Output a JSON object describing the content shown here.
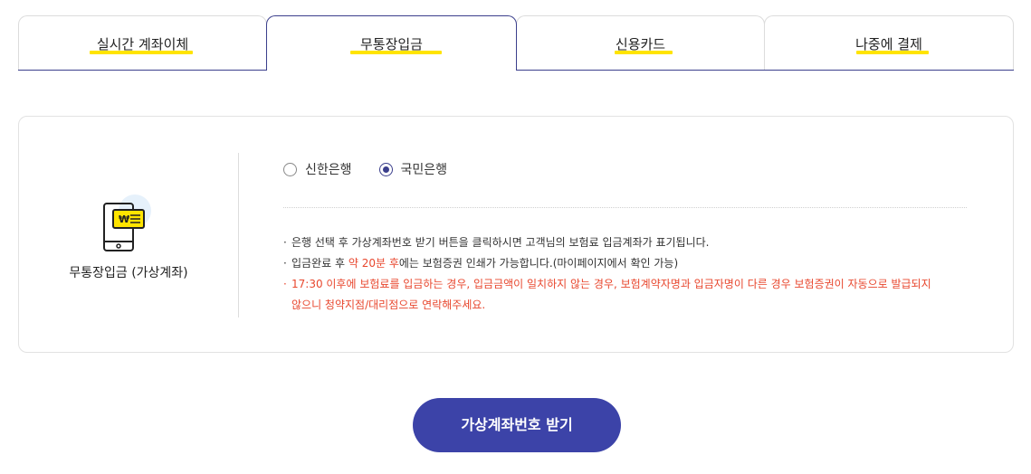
{
  "tabs": [
    {
      "label": "실시간 계좌이체",
      "active": false
    },
    {
      "label": "무통장입금",
      "active": true
    },
    {
      "label": "신용카드",
      "active": false
    },
    {
      "label": "나중에 결제",
      "active": false
    }
  ],
  "panel": {
    "method_label": "무통장입금 (가상계좌)",
    "icon": "mobile-bank-transfer-icon",
    "banks": [
      {
        "label": "신한은행",
        "checked": false
      },
      {
        "label": "국민은행",
        "checked": true
      }
    ],
    "notes": {
      "line1": "은행 선택 후 가상계좌번호 받기 버튼을 클릭하시면 고객님의 보험료 입금계좌가 표기됩니다.",
      "line2_pre": "입금완료 후 ",
      "line2_highlight": "약 20분 후",
      "line2_post": "에는 보험증권 인쇄가 가능합니다.(마이페이지에서 확인 가능)",
      "line3_a": "17:30 이후에 보험료를 입금하는 경우, 입금금액이 일치하지 않는 경우, 보험계약자명과 입금자명이 다른 경우 보험증권이 자동으로 발급되지",
      "line3_b": "않으니 청약지점/대리점으로 연락해주세요."
    }
  },
  "submit_label": "가상계좌번호 받기",
  "colors": {
    "primary": "#3c43a8",
    "highlight": "#ffe400",
    "warning": "#e8472e"
  }
}
